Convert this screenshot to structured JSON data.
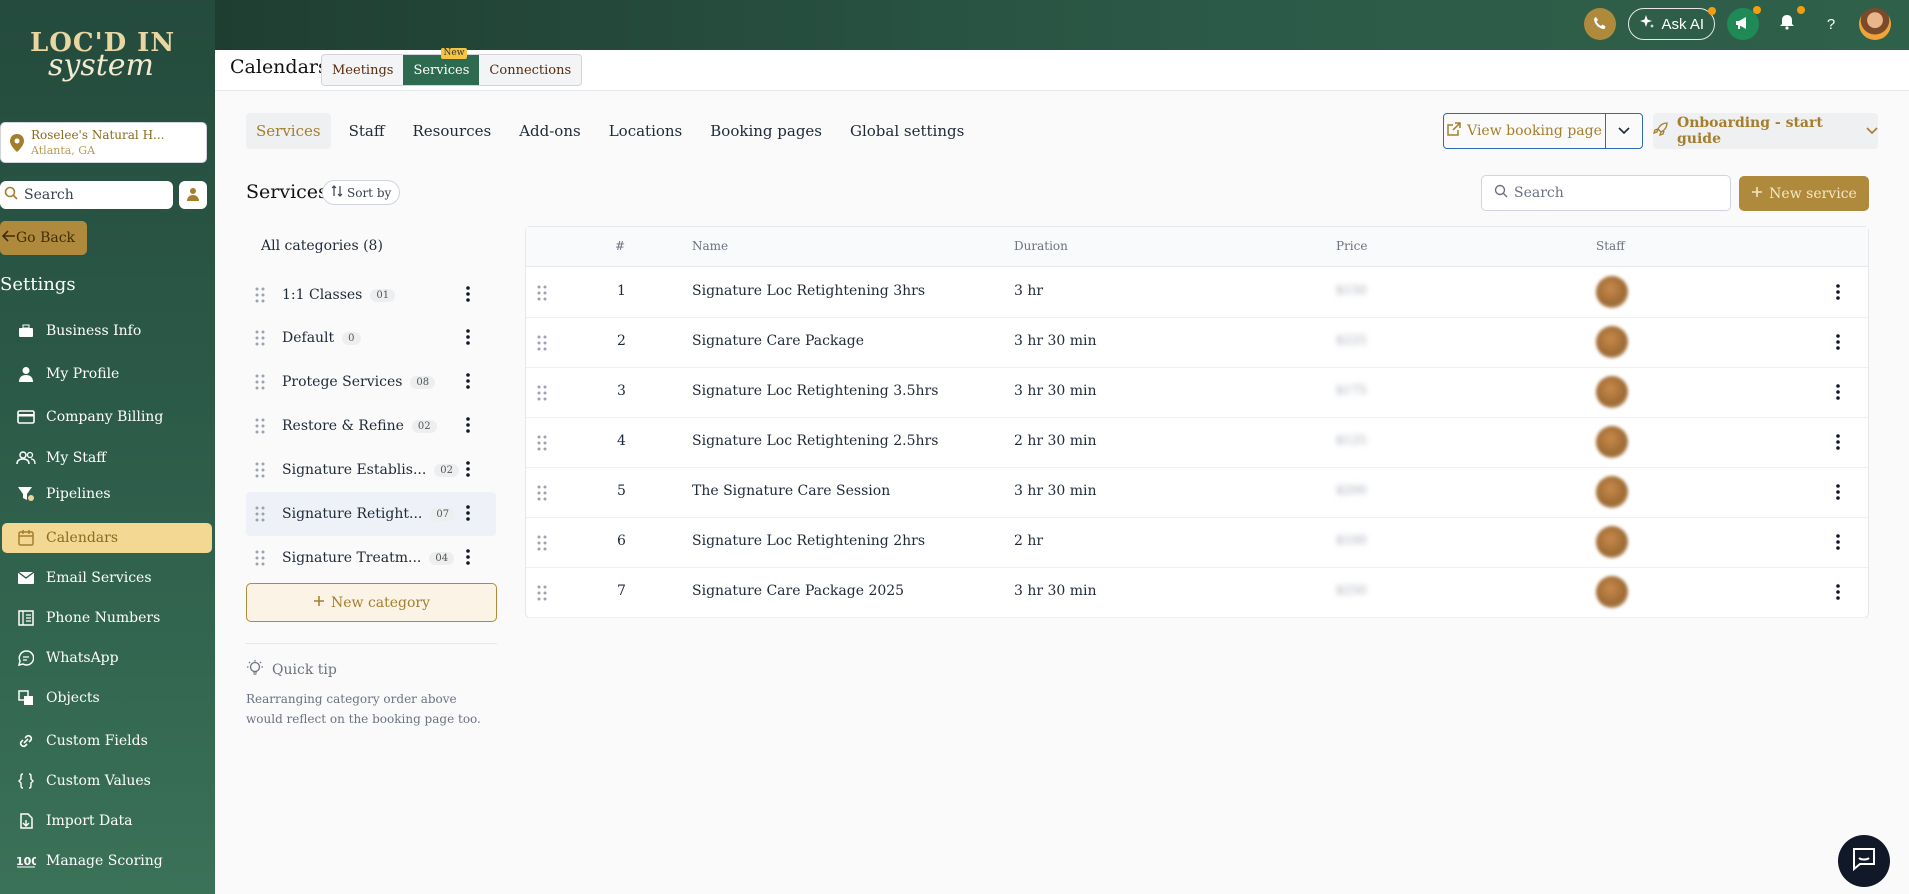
{
  "brand": {
    "logo_line1": "LOC'D IN",
    "logo_line2": "system"
  },
  "location": {
    "name": "Roselee's Natural H...",
    "city": "Atlanta, GA"
  },
  "sidebar": {
    "search_label": "Search",
    "go_back": "Go Back",
    "settings_heading": "Settings",
    "items": [
      {
        "label": "Business Info",
        "icon": "briefcase-icon"
      },
      {
        "label": "My Profile",
        "icon": "user-icon"
      },
      {
        "label": "Company Billing",
        "icon": "credit-card-icon"
      },
      {
        "label": "My Staff",
        "icon": "users-icon"
      },
      {
        "label": "Pipelines",
        "icon": "funnel-icon"
      },
      {
        "label": "Calendars",
        "icon": "calendar-icon",
        "active": true
      },
      {
        "label": "Email Services",
        "icon": "mail-icon"
      },
      {
        "label": "Phone Numbers",
        "icon": "phone-book-icon"
      },
      {
        "label": "WhatsApp",
        "icon": "chat-bubble-icon"
      },
      {
        "label": "Objects",
        "icon": "objects-icon"
      },
      {
        "label": "Custom Fields",
        "icon": "link-icon"
      },
      {
        "label": "Custom Values",
        "icon": "braces-icon"
      },
      {
        "label": "Import Data",
        "icon": "file-import-icon"
      },
      {
        "label": "Manage Scoring",
        "icon": "score-100-icon"
      }
    ]
  },
  "topbar": {
    "ask_ai": "Ask AI",
    "help": "?"
  },
  "header": {
    "title": "Calendars",
    "segments": [
      {
        "label": "Meetings"
      },
      {
        "label": "Services",
        "badge": "New",
        "active": true
      },
      {
        "label": "Connections"
      }
    ]
  },
  "tabs": [
    "Services",
    "Staff",
    "Resources",
    "Add-ons",
    "Locations",
    "Booking pages",
    "Global settings"
  ],
  "actions": {
    "view_booking_page": "View booking page",
    "onboarding": "Onboarding - start guide"
  },
  "services": {
    "title": "Services",
    "sort_by": "Sort by",
    "search_placeholder": "Search",
    "new_service": "New service"
  },
  "categories": {
    "all_label": "All categories (8)",
    "items": [
      {
        "name": "1:1 Classes",
        "count": "01"
      },
      {
        "name": "Default",
        "count": "0"
      },
      {
        "name": "Protege Services",
        "count": "08"
      },
      {
        "name": "Restore & Refine",
        "count": "02"
      },
      {
        "name": "Signature Establis...",
        "count": "02"
      },
      {
        "name": "Signature Retight...",
        "count": "07",
        "selected": true
      },
      {
        "name": "Signature Treatm...",
        "count": "04"
      }
    ],
    "new_category": "New category"
  },
  "tip": {
    "title": "Quick tip",
    "body": "Rearranging category order above would reflect on the booking page too."
  },
  "table": {
    "columns": [
      "#",
      "Name",
      "Duration",
      "Price",
      "Staff"
    ],
    "rows": [
      {
        "num": "1",
        "name": "Signature Loc Retightening 3hrs",
        "duration": "3 hr",
        "price": "$150"
      },
      {
        "num": "2",
        "name": "Signature Care Package",
        "duration": "3 hr 30 min",
        "price": "$225"
      },
      {
        "num": "3",
        "name": "Signature Loc Retightening 3.5hrs",
        "duration": "3 hr 30 min",
        "price": "$175"
      },
      {
        "num": "4",
        "name": "Signature Loc Retightening 2.5hrs",
        "duration": "2 hr 30 min",
        "price": "$125"
      },
      {
        "num": "5",
        "name": "The Signature Care Session",
        "duration": "3 hr 30 min",
        "price": "$200"
      },
      {
        "num": "6",
        "name": "Signature Loc Retightening 2hrs",
        "duration": "2 hr",
        "price": "$100"
      },
      {
        "num": "7",
        "name": "Signature Care Package 2025",
        "duration": "3 hr 30 min",
        "price": "$250"
      }
    ]
  },
  "colors": {
    "accent": "#b08a3c",
    "sidebar_green": "#2c5a48",
    "active_nav": "#f2d892"
  }
}
